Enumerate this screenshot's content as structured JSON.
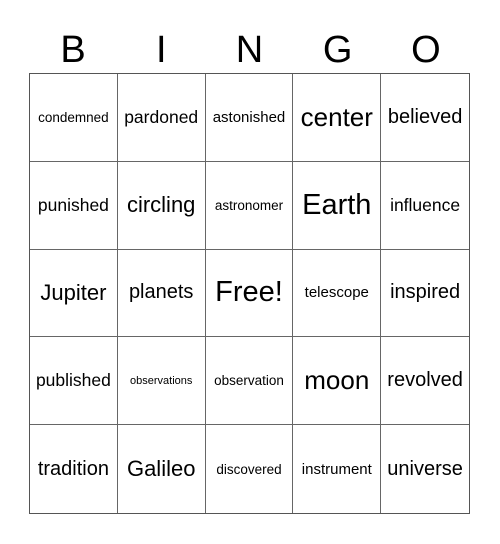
{
  "header": [
    "B",
    "I",
    "N",
    "G",
    "O"
  ],
  "cells": [
    [
      "condemned",
      "pardoned",
      "astonished",
      "center",
      "believed"
    ],
    [
      "punished",
      "circling",
      "astronomer",
      "Earth",
      "influence"
    ],
    [
      "Jupiter",
      "planets",
      "Free!",
      "telescope",
      "inspired"
    ],
    [
      "published",
      "observations",
      "observation",
      "moon",
      "revolved"
    ],
    [
      "tradition",
      "Galileo",
      "discovered",
      "instrument",
      "universe"
    ]
  ]
}
